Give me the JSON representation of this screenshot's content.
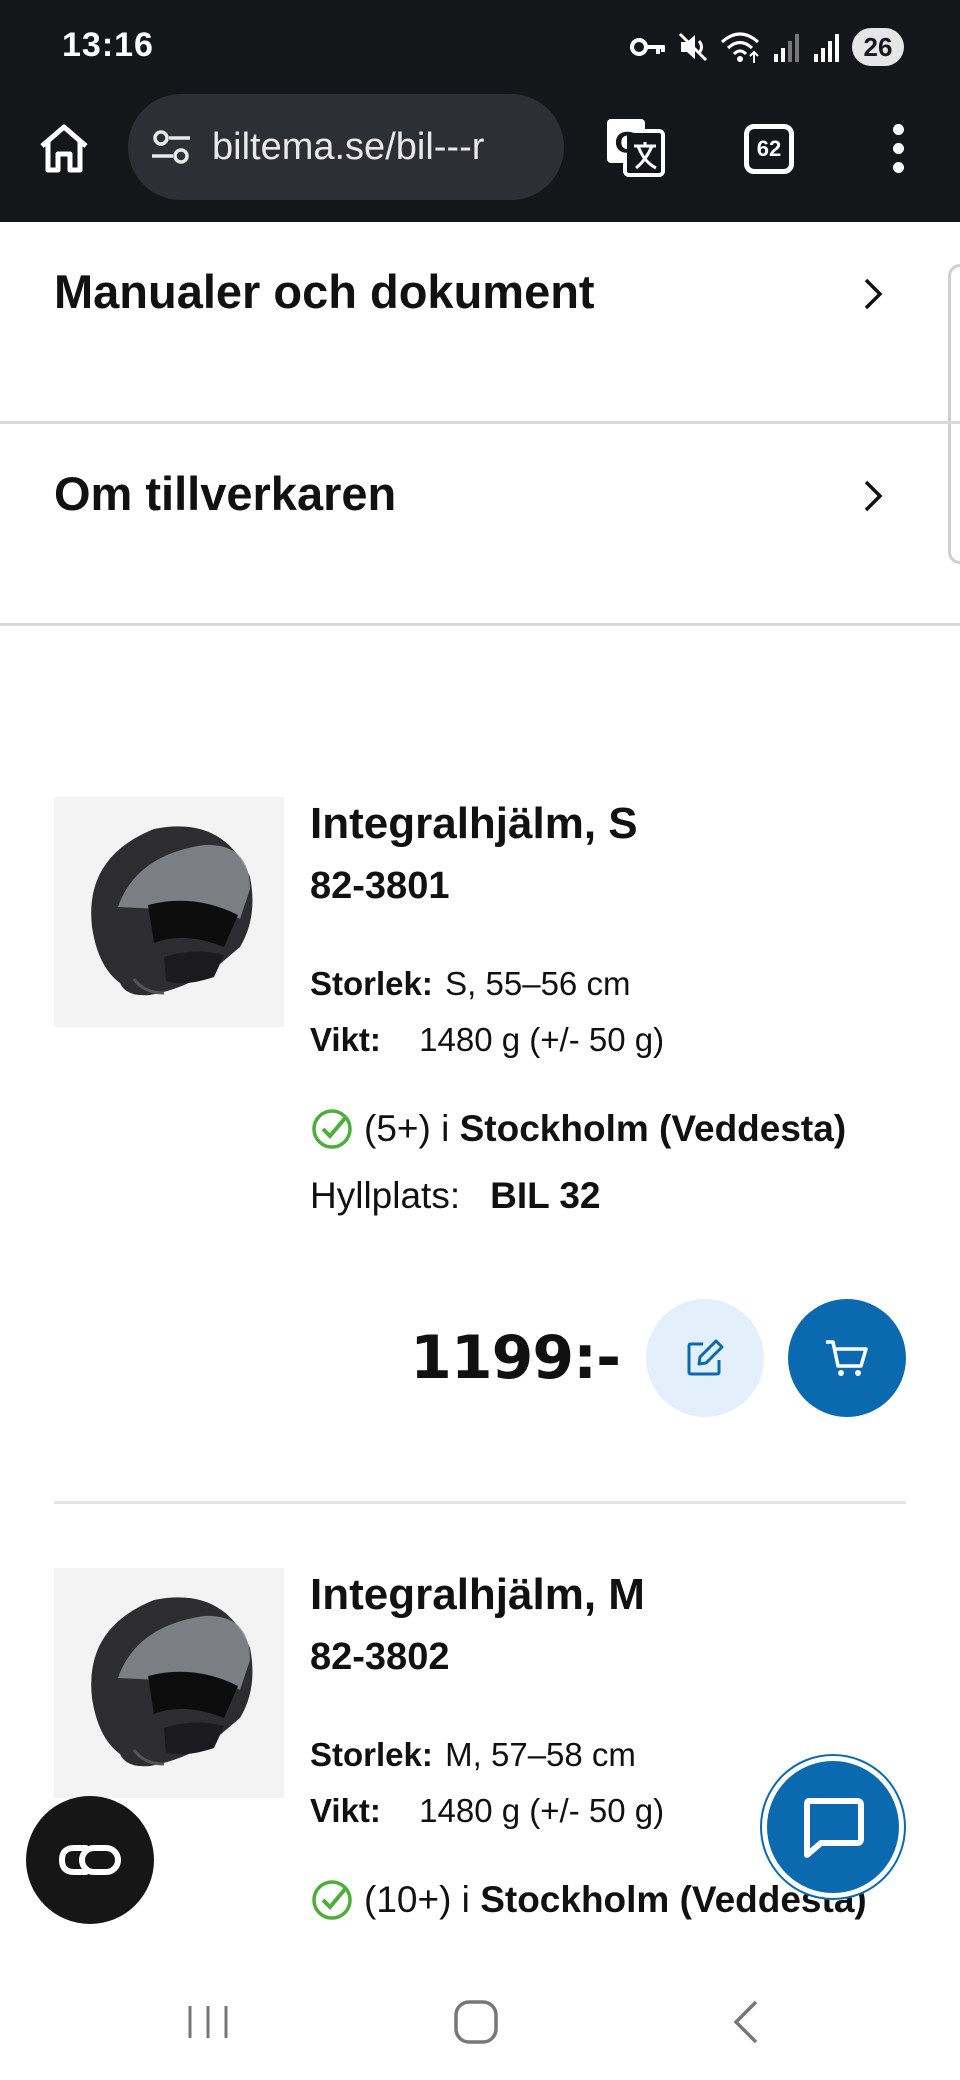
{
  "status_bar": {
    "time": "13:16",
    "battery": "26",
    "icons": [
      "vpn-key-icon",
      "mute-icon",
      "wifi-icon",
      "signal-icon",
      "signal-icon"
    ]
  },
  "browser": {
    "url": "biltema.se/bil---r",
    "tab_count": "62",
    "icons": [
      "home-icon",
      "site-settings-icon",
      "translate-icon",
      "tabs-icon",
      "more-vert-icon"
    ]
  },
  "accordion": [
    {
      "label": "Manualer och dokument"
    },
    {
      "label": "Om tillverkaren"
    }
  ],
  "products": [
    {
      "title": "Integralhjälm, S",
      "sku": "82-3801",
      "size_label": "Storlek:",
      "size_value": "S, 55–56 cm",
      "weight_label": "Vikt:",
      "weight_value": "1480 g (+/- 50 g)",
      "stock_count": "(5+) i",
      "stock_store": "Stockholm (Veddesta)",
      "shelf_label": "Hyllplats:",
      "shelf_value": "BIL 32",
      "price": "1199:-"
    },
    {
      "title": "Integralhjälm, M",
      "sku": "82-3802",
      "size_label": "Storlek:",
      "size_value": "M, 57–58 cm",
      "weight_label": "Vikt:",
      "weight_value": "1480 g (+/- 50 g)",
      "stock_count": "(10+) i",
      "stock_store": "Stockholm (Veddesta)"
    }
  ],
  "colors": {
    "brand_blue": "#0b6aaf",
    "light_blue": "#e3f0fb",
    "stock_green": "#4caf3a",
    "dark_bar": "#15161a"
  }
}
